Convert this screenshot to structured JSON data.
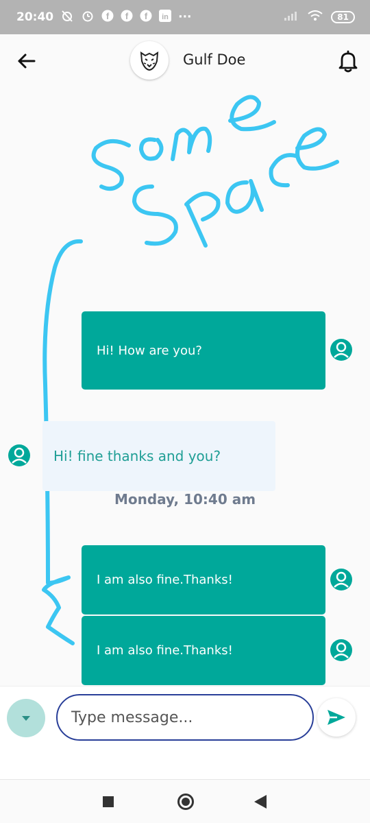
{
  "status_bar": {
    "time": "20:40",
    "icons": [
      "muted-alarm-icon",
      "alarm-icon",
      "facebook-icon",
      "facebook-icon",
      "facebook-icon",
      "linkedin-icon",
      "more-notifications-icon"
    ],
    "more": "···",
    "battery": "81"
  },
  "header": {
    "contact_name": "Gulf Doe",
    "avatar": "tiger-logo-icon"
  },
  "annotation": {
    "handwritten": "Some Space"
  },
  "messages": [
    {
      "direction": "outgoing",
      "text": "Hi! How are you?"
    },
    {
      "direction": "incoming",
      "text": "Hi! fine thanks and you?"
    },
    {
      "direction": "outgoing",
      "text": "I am also fine.Thanks!"
    },
    {
      "direction": "outgoing",
      "text": "I am also fine.Thanks!"
    }
  ],
  "date_separator": "Monday, 10:40 am",
  "composer": {
    "placeholder": "Type message..."
  },
  "colors": {
    "accent": "#00a89a",
    "incoming_bubble": "#eef5fc",
    "input_border": "#283e98",
    "annotation": "#3cc6f2"
  }
}
